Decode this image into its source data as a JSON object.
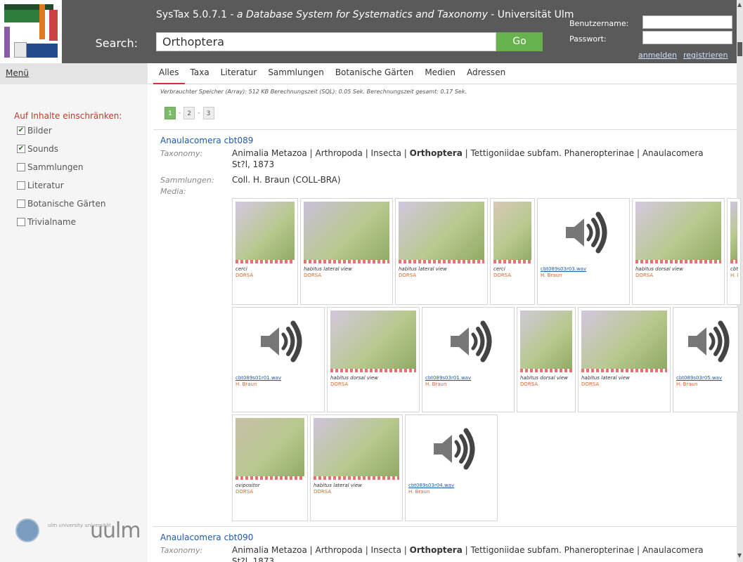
{
  "header": {
    "title_main": "SysTax 5.0.7.1 - ",
    "title_italic": "a Database System for Systematics and Taxonomy",
    "title_end": " - Universität Ulm",
    "search_label": "Search:",
    "search_value": "Orthoptera",
    "go_label": "Go",
    "username_label": "Benutzername:",
    "password_label": "Passwort:",
    "login_link": "anmelden",
    "register_link": "registrieren"
  },
  "menu": {
    "label": "Menü"
  },
  "tabs": [
    {
      "label": "Alles",
      "active": true
    },
    {
      "label": "Taxa"
    },
    {
      "label": "Literatur"
    },
    {
      "label": "Sammlungen"
    },
    {
      "label": "Botanische Gärten"
    },
    {
      "label": "Medien"
    },
    {
      "label": "Adressen"
    }
  ],
  "sidebar": {
    "filter_title": "Auf Inhalte einschränken:",
    "filters": [
      {
        "label": "Bilder",
        "checked": true
      },
      {
        "label": "Sounds",
        "checked": true
      },
      {
        "label": "Sammlungen",
        "checked": false
      },
      {
        "label": "Literatur",
        "checked": false
      },
      {
        "label": "Botanische Gärten",
        "checked": false
      },
      {
        "label": "Trivialname",
        "checked": false
      }
    ],
    "footer_small": "ulm university  universität",
    "footer_big": "uulm"
  },
  "stats": "Verbrauchter Speicher (Array): 512 KB   Berechnungszeit (SQL): 0.05 Sek.   Berechnungszeit gesamt: 0.17 Sek.",
  "pager": {
    "pages": [
      "1",
      "2",
      "3"
    ],
    "separator": "-",
    "current": "1"
  },
  "labels": {
    "taxonomy": "Taxonomy:",
    "collections": "Sammlungen:",
    "media": "Media:"
  },
  "records": [
    {
      "title": "Anaulacomera cbt089",
      "taxonomy_pre": "Animalia Metazoa | Arthropoda | Insecta | ",
      "taxonomy_bold": "Orthoptera",
      "taxonomy_post": " | Tettigoniidae subfam. Phaneropterinae | Anaulacomera",
      "taxonomy_line2": "St?l, 1873",
      "collection": "Coll. H. Braun (COLL-BRA)",
      "media": [
        {
          "kind": "image",
          "caption": "cerci",
          "source": "DORSA"
        },
        {
          "kind": "image",
          "caption": "habitus lateral view",
          "source": "DORSA"
        },
        {
          "kind": "image",
          "caption": "habitus lateral view",
          "source": "DORSA"
        },
        {
          "kind": "image",
          "caption": "cerci",
          "source": "DORSA"
        },
        {
          "kind": "sound",
          "caption": "cbt089s03r03.wav",
          "source": "H. Braun"
        },
        {
          "kind": "image",
          "caption": "habitus dorsal view",
          "source": "DORSA"
        },
        {
          "kind": "image",
          "caption": "cbt",
          "source": "H. I"
        },
        {
          "kind": "sound",
          "caption": "cbt089s01r01.wav",
          "source": "H. Braun"
        },
        {
          "kind": "image",
          "caption": "habitus dorsal view",
          "source": "DORSA"
        },
        {
          "kind": "sound",
          "caption": "cbt089s03r01.wav",
          "source": "H. Braun"
        },
        {
          "kind": "image",
          "caption": "habitus dorsal view",
          "source": "DORSA"
        },
        {
          "kind": "image",
          "caption": "habitus lateral view",
          "source": "DORSA"
        },
        {
          "kind": "sound",
          "caption": "cbt089s03r05.wav",
          "source": "H. Braun"
        },
        {
          "kind": "image",
          "caption": "ovipositor",
          "source": "DORSA"
        },
        {
          "kind": "image",
          "caption": "habitus lateral view",
          "source": "DORSA"
        },
        {
          "kind": "sound",
          "caption": "cbt089s03r04.wav",
          "source": "H. Braun"
        }
      ]
    },
    {
      "title": "Anaulacomera cbt090",
      "taxonomy_pre": "Animalia Metazoa | Arthropoda | Insecta | ",
      "taxonomy_bold": "Orthoptera",
      "taxonomy_post": " | Tettigoniidae subfam. Phaneropterinae | Anaulacomera",
      "taxonomy_line2": "St?l, 1873"
    }
  ],
  "colors": {
    "header_bg": "#5a5a5a",
    "go_button": "#66b24c",
    "link": "#1e5aa8",
    "accent_red": "#c0392b",
    "source_orange": "#d9662b"
  }
}
